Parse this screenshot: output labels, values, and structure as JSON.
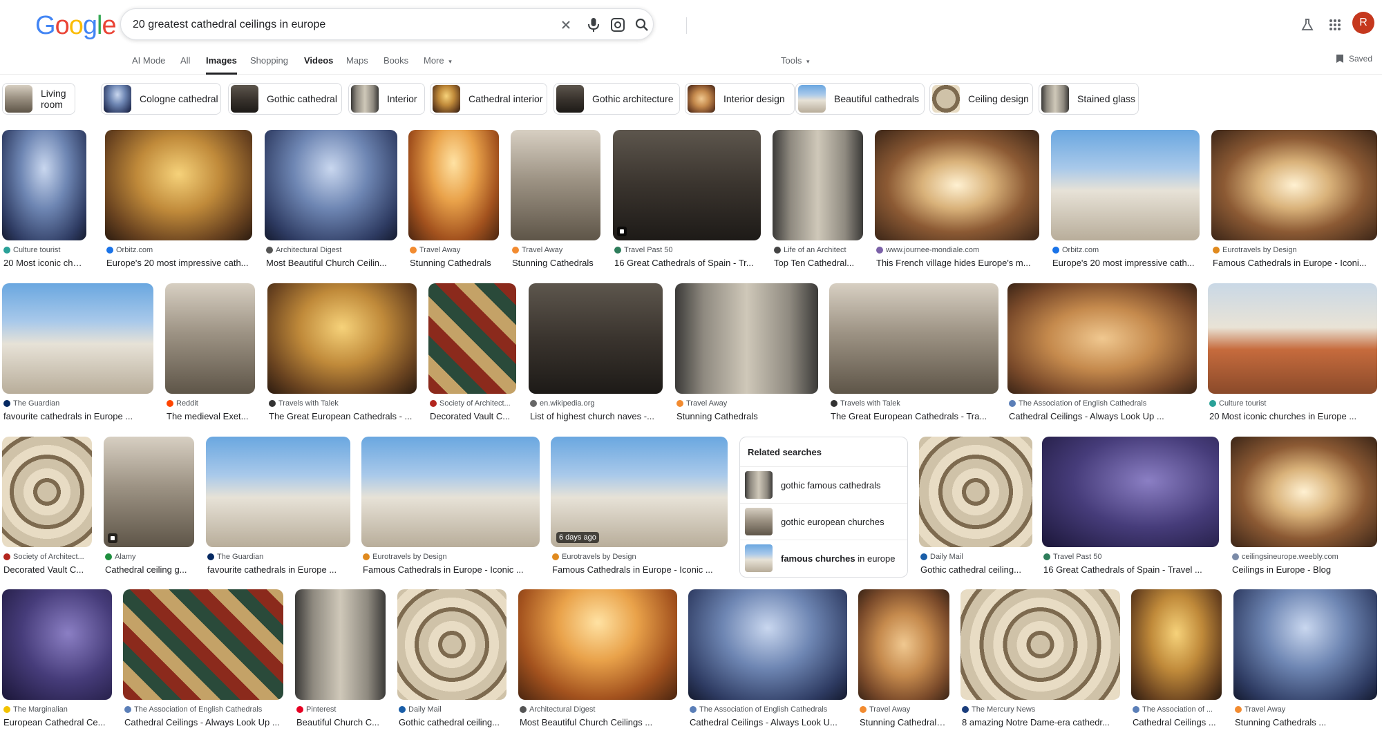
{
  "search": {
    "query": "20 greatest cathedral ceilings in europe"
  },
  "header": {
    "logo_letters": [
      {
        "ch": "G",
        "color": "#4285F4"
      },
      {
        "ch": "o",
        "color": "#EA4335"
      },
      {
        "ch": "o",
        "color": "#FBBC05"
      },
      {
        "ch": "g",
        "color": "#4285F4"
      },
      {
        "ch": "l",
        "color": "#34A853"
      },
      {
        "ch": "e",
        "color": "#EA4335"
      }
    ],
    "avatar_letter": "R",
    "avatar_color": "#c5381e"
  },
  "tabs": [
    {
      "label": "AI Mode"
    },
    {
      "label": "All"
    },
    {
      "label": "Images",
      "active": true
    },
    {
      "label": "Shopping"
    },
    {
      "label": "Videos",
      "bold": true
    },
    {
      "label": "Maps"
    },
    {
      "label": "Books"
    },
    {
      "label": "More"
    }
  ],
  "tools_label": "Tools",
  "saved_label": "Saved",
  "chips": [
    "Living room",
    "Cologne cathedral",
    "Gothic cathedral",
    "Interior",
    "Cathedral interior",
    "Gothic architecture",
    "Interior design",
    "Beautiful cathedrals",
    "Ceiling design",
    "Stained glass"
  ],
  "results": [
    {
      "source": "Culture tourist",
      "title": "20 Most iconic chu...",
      "src_color": "#2aa198"
    },
    {
      "source": "Orbitz.com",
      "title": "Europe's 20 most impressive cath...",
      "src_color": "#1a73e8"
    },
    {
      "source": "Architectural Digest",
      "title": "Most Beautiful Church Ceilin...",
      "src_color": "#555555"
    },
    {
      "source": "Travel Away",
      "title": "Stunning Cathedrals",
      "src_color": "#f28b30"
    },
    {
      "source": "Travel Away",
      "title": "Stunning Cathedrals",
      "src_color": "#f28b30"
    },
    {
      "source": "Travel Past 50",
      "title": "16 Great Cathedrals of Spain - Tr...",
      "src_color": "#2e7d5b"
    },
    {
      "source": "Life of an Architect",
      "title": "Top Ten Cathedral...",
      "src_color": "#444444"
    },
    {
      "source": "www.journee-mondiale.com",
      "title": "This French village hides Europe's m...",
      "src_color": "#7b61a8"
    },
    {
      "source": "Orbitz.com",
      "title": "Europe's 20 most impressive cath...",
      "src_color": "#1a73e8"
    },
    {
      "source": "Eurotravels by Design",
      "title": "Famous Cathedrals in Europe - Iconi...",
      "src_color": "#e08a1e"
    },
    {
      "source": "The Guardian",
      "title": "favourite cathedrals in Europe ...",
      "src_color": "#052962"
    },
    {
      "source": "Reddit",
      "title": "The medieval Exet...",
      "src_color": "#ff4500"
    },
    {
      "source": "Travels with Talek",
      "title": "The Great European Cathedrals - ...",
      "src_color": "#333333"
    },
    {
      "source": "Society of Architect...",
      "title": "Decorated Vault C...",
      "src_color": "#b3261e"
    },
    {
      "source": "en.wikipedia.org",
      "title": "List of highest church naves -...",
      "src_color": "#666666"
    },
    {
      "source": "Travel Away",
      "title": "Stunning Cathedrals",
      "src_color": "#f28b30"
    },
    {
      "source": "Travels with Talek",
      "title": "The Great European Cathedrals - Tra...",
      "src_color": "#333333"
    },
    {
      "source": "The Association of English Cathedrals",
      "title": "Cathedral Ceilings - Always Look Up ...",
      "src_color": "#5b7fb8"
    },
    {
      "source": "Culture tourist",
      "title": "20 Most iconic churches in Europe ...",
      "src_color": "#2aa198"
    },
    {
      "source": "Society of Architect...",
      "title": "Decorated Vault C...",
      "src_color": "#b3261e"
    },
    {
      "source": "Alamy",
      "title": "Cathedral ceiling g...",
      "src_color": "#1e8e3e"
    },
    {
      "source": "The Guardian",
      "title": "favourite cathedrals in Europe ...",
      "src_color": "#052962"
    },
    {
      "source": "Eurotravels by Design",
      "title": "Famous Cathedrals in Europe - Iconic ...",
      "src_color": "#e08a1e"
    },
    {
      "source": "Eurotravels by Design",
      "title": "Famous Cathedrals in Europe - Iconic ...",
      "src_color": "#e08a1e"
    },
    {
      "source": "Daily Mail",
      "title": "Gothic cathedral ceiling...",
      "src_color": "#1a5ea8"
    },
    {
      "source": "Travel Past 50",
      "title": "16 Great Cathedrals of Spain - Travel ...",
      "src_color": "#2e7d5b"
    },
    {
      "source": "ceilingsineurope.weebly.com",
      "title": "Ceilings in Europe - Blog",
      "src_color": "#7b8ba8"
    },
    {
      "source": "The Marginalian",
      "title": "European Cathedral Ce...",
      "src_color": "#f2c200"
    },
    {
      "source": "The Association of English Cathedrals",
      "title": "Cathedral Ceilings - Always Look Up ...",
      "src_color": "#5b7fb8"
    },
    {
      "source": "Pinterest",
      "title": "Beautiful Church C...",
      "src_color": "#e60023"
    },
    {
      "source": "Daily Mail",
      "title": "Gothic cathedral ceiling...",
      "src_color": "#1a5ea8"
    },
    {
      "source": "Architectural Digest",
      "title": "Most Beautiful Church Ceilings ...",
      "src_color": "#555555"
    },
    {
      "source": "The Association of English Cathedrals",
      "title": "Cathedral Ceilings - Always Look U...",
      "src_color": "#5b7fb8"
    },
    {
      "source": "Travel Away",
      "title": "Stunning Cathedrals ...",
      "src_color": "#f28b30"
    },
    {
      "source": "The Mercury News",
      "title": "8 amazing Notre Dame-era cathedr...",
      "src_color": "#1a3d7c"
    },
    {
      "source": "The Association of ...",
      "title": "Cathedral Ceilings ...",
      "src_color": "#5b7fb8"
    },
    {
      "source": "Travel Away",
      "title": "Stunning Cathedrals ...",
      "src_color": "#f28b30"
    }
  ],
  "badges": {
    "six_days_ago": "6 days ago"
  },
  "related": {
    "heading": "Related searches",
    "items": [
      {
        "plain": "gothic famous cathedrals",
        "bold": ""
      },
      {
        "plain": "gothic european churches",
        "bold": ""
      },
      {
        "plain": " in europe",
        "bold": "famous churches"
      }
    ]
  }
}
